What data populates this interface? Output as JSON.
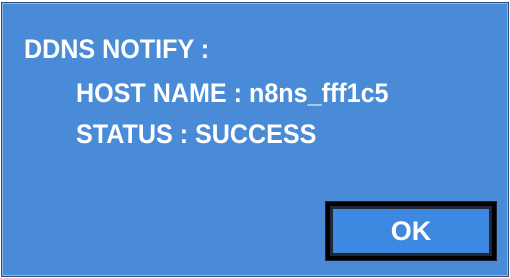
{
  "dialog": {
    "title": "DDNS NOTIFY :",
    "host_label": "HOST NAME : n8ns_fff1c5",
    "status_label": "STATUS : SUCCESS"
  },
  "buttons": {
    "ok_label": "OK"
  },
  "colors": {
    "dialog_background": "#4a8bd7",
    "button_background": "#3d88e0",
    "button_frame": "#000000",
    "text": "#ffffff"
  }
}
